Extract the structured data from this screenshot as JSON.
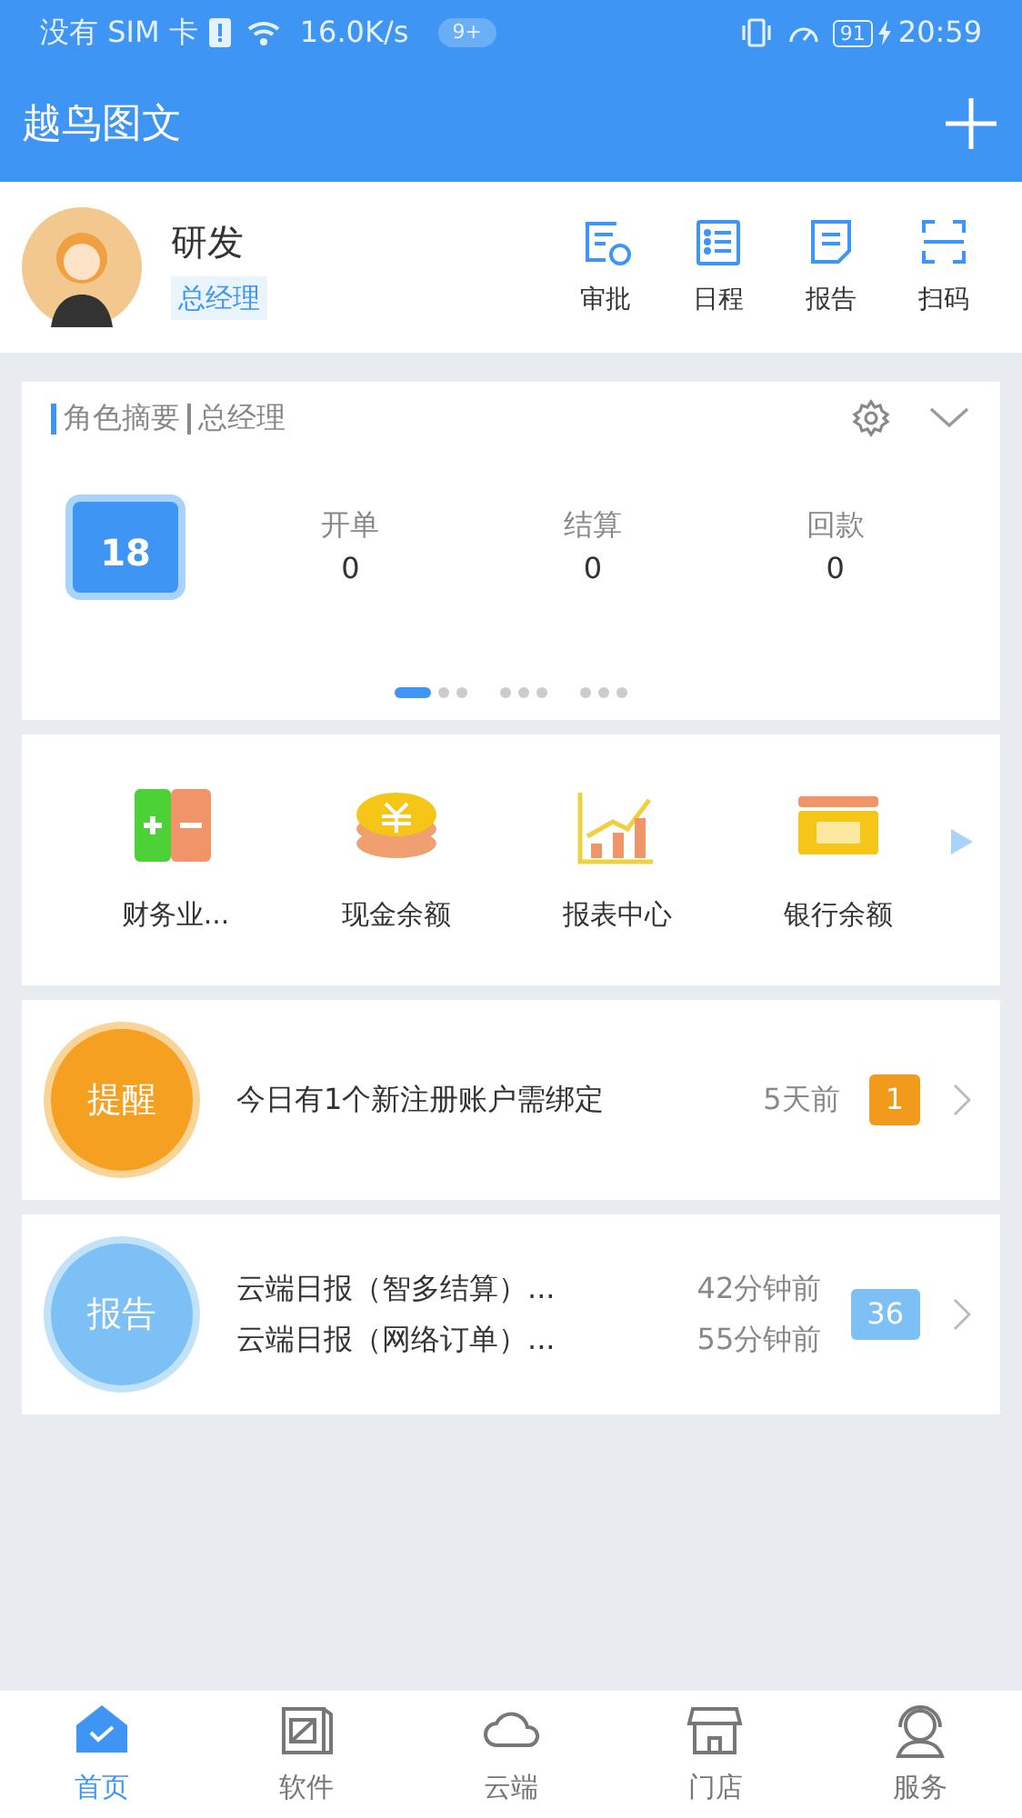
{
  "status_bar": {
    "carrier": "没有 SIM 卡",
    "speed": "16.0K/s",
    "notifications": "9+",
    "battery": "91",
    "time": "20:59"
  },
  "app_bar": {
    "title": "越鸟图文"
  },
  "profile": {
    "name": "研发",
    "role": "总经理"
  },
  "quick_actions": [
    {
      "label": "审批",
      "kind": "approve"
    },
    {
      "label": "日程",
      "kind": "schedule"
    },
    {
      "label": "报告",
      "kind": "report"
    },
    {
      "label": "扫码",
      "kind": "scan"
    }
  ],
  "summary": {
    "title": "角色摘要",
    "role": "总经理",
    "date": "18",
    "stats": [
      {
        "label": "开单",
        "value": "0"
      },
      {
        "label": "结算",
        "value": "0"
      },
      {
        "label": "回款",
        "value": "0"
      }
    ],
    "pager": [
      {
        "selected": true
      },
      {
        "selected": false
      },
      {
        "selected": false
      },
      {
        "selected": false
      },
      {
        "selected": false
      },
      {
        "selected": false
      },
      {
        "selected": false
      },
      {
        "selected": false
      },
      {
        "selected": false
      }
    ]
  },
  "shortcuts": [
    {
      "label": "财务业...",
      "kind": "plusminus"
    },
    {
      "label": "现金余额",
      "kind": "coins"
    },
    {
      "label": "报表中心",
      "kind": "chart"
    },
    {
      "label": "银行余额",
      "kind": "card"
    }
  ],
  "messages": [
    {
      "kind": "reminder",
      "badge": "提醒",
      "color": "#f5a020",
      "lines": [
        {
          "text": "今日有1个新注册账户需绑定",
          "time": "5天前"
        }
      ],
      "count": "1"
    },
    {
      "kind": "report",
      "badge": "报告",
      "color": "#7cc0f5",
      "lines": [
        {
          "text": "云端日报（智多结算）...",
          "time": "42分钟前"
        },
        {
          "text": "云端日报（网络订单）...",
          "time": "55分钟前"
        }
      ],
      "count": "36"
    }
  ],
  "nav": [
    {
      "label": "首页",
      "kind": "home",
      "selected": true
    },
    {
      "label": "软件",
      "kind": "box",
      "selected": false
    },
    {
      "label": "云端",
      "kind": "cloud",
      "selected": false
    },
    {
      "label": "门店",
      "kind": "store",
      "selected": false
    },
    {
      "label": "服务",
      "kind": "service",
      "selected": false
    }
  ]
}
